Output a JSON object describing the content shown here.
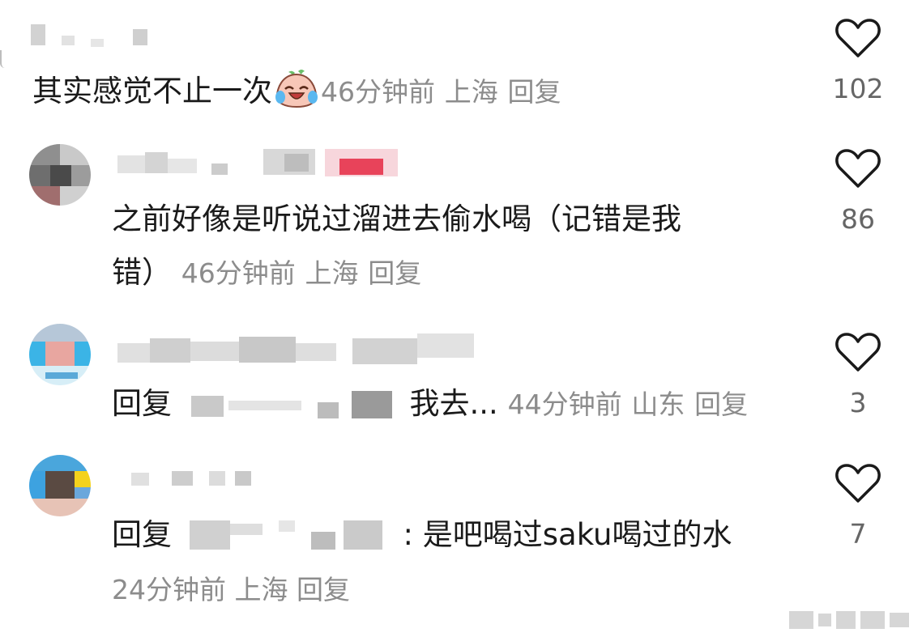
{
  "comments": [
    {
      "text": "其实感觉不止一次",
      "emoji": "crying-laughing-emoji",
      "time": "46分钟前",
      "location": "上海",
      "reply_label": "回复",
      "likes": "102"
    },
    {
      "text_line1": "之前好像是听说过溜进去偷水喝（记错是我",
      "text_line2": "错）",
      "time": "46分钟前",
      "location": "上海",
      "reply_label": "回复",
      "likes": "86"
    },
    {
      "reply_prefix": "回复",
      "text": "我去...",
      "time": "44分钟前",
      "location": "山东",
      "reply_label": "回复",
      "likes": "3"
    },
    {
      "reply_prefix": "回复",
      "text": ": 是吧喝过saku喝过的水",
      "time": "24分钟前",
      "location": "上海",
      "reply_label": "回复",
      "likes": "7"
    }
  ],
  "icons": {
    "like": "heart-outline-icon"
  },
  "colors": {
    "text": "#1a1a1a",
    "meta": "#8c8c8c",
    "count": "#666666",
    "heart_stroke": "#1a1a1a"
  }
}
